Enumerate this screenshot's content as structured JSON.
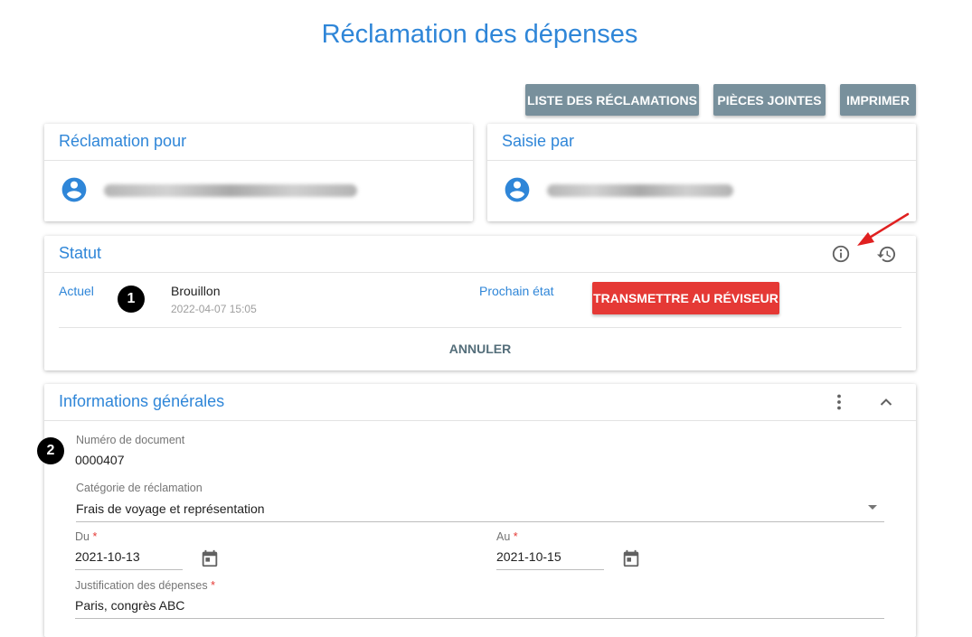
{
  "page": {
    "title": "Réclamation des dépenses"
  },
  "toolbar": {
    "list_label": "LISTE DES RÉCLAMATIONS",
    "attachments_label": "PIÈCES JOINTES",
    "print_label": "IMPRIMER"
  },
  "claim_for": {
    "title": "Réclamation pour"
  },
  "entered_by": {
    "title": "Saisie par"
  },
  "status": {
    "title": "Statut",
    "current_label": "Actuel",
    "marker": "1",
    "current_value": "Brouillon",
    "current_date": "2022-04-07 15:05",
    "next_label": "Prochain état",
    "transmit_label": "TRANSMETTRE AU RÉVISEUR",
    "cancel_label": "ANNULER"
  },
  "general": {
    "title": "Informations générales",
    "marker": "2",
    "doc_number_label": "Numéro de document",
    "doc_number_value": "0000407",
    "category_label": "Catégorie de réclamation",
    "category_value": "Frais de voyage et représentation",
    "from_label": "Du",
    "from_value": "2021-10-13",
    "to_label": "Au",
    "to_value": "2021-10-15",
    "justification_label": "Justification des dépenses",
    "justification_value": "Paris, congrès ABC",
    "required_mark": "*"
  },
  "colors": {
    "accent": "#2f86d8",
    "button_grey": "#78909c",
    "button_red": "#e53935",
    "annotation_arrow": "#e02020"
  },
  "icons": [
    "account-circle-icon",
    "info-icon",
    "history-icon",
    "more-vert-icon",
    "chevron-up-icon",
    "dropdown-arrow-icon",
    "calendar-icon"
  ]
}
